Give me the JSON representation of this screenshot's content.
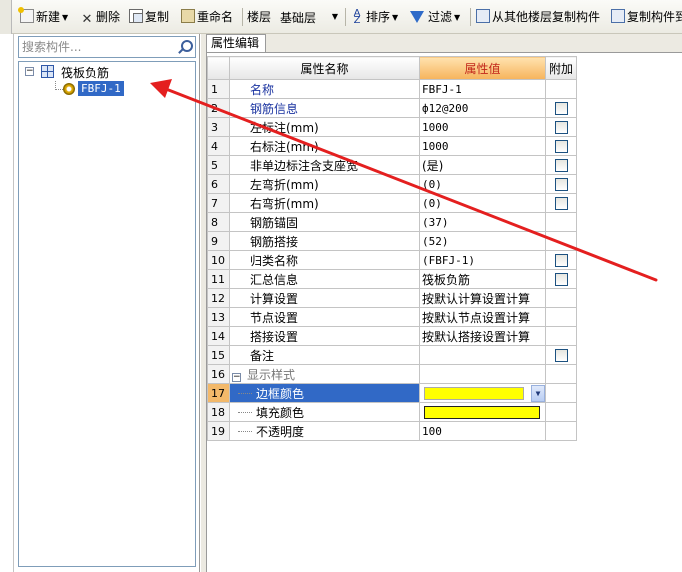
{
  "toolbar": {
    "new_label": "新建",
    "delete_label": "删除",
    "copy_label": "复制",
    "rename_label": "重命名",
    "floor_label": "楼层",
    "floor_value": "基础层",
    "sort_label": "排序",
    "filter_label": "过滤",
    "copy_from_floor_label": "从其他楼层复制构件",
    "copy_component_label": "复制构件到"
  },
  "left_panel": {
    "search_placeholder": "搜索构件...",
    "tree": {
      "root_label": "筏板负筋",
      "child_label": "FBFJ-1"
    }
  },
  "right_panel": {
    "tab_label": "属性编辑",
    "headers": {
      "name": "属性名称",
      "value": "属性值",
      "extra": "附加"
    },
    "rows": [
      {
        "num": "1",
        "name": "名称",
        "value": "FBFJ-1"
      },
      {
        "num": "2",
        "name": "钢筋信息",
        "value": "ф12@200"
      },
      {
        "num": "3",
        "name": "左标注(mm)",
        "value": "1000"
      },
      {
        "num": "4",
        "name": "右标注(mm)",
        "value": "1000"
      },
      {
        "num": "5",
        "name": "非单边标注含支座宽",
        "value": "(是)"
      },
      {
        "num": "6",
        "name": "左弯折(mm)",
        "value": "(0)"
      },
      {
        "num": "7",
        "name": "右弯折(mm)",
        "value": "(0)"
      },
      {
        "num": "8",
        "name": "钢筋锚固",
        "value": "(37)"
      },
      {
        "num": "9",
        "name": "钢筋搭接",
        "value": "(52)"
      },
      {
        "num": "10",
        "name": "归类名称",
        "value": "(FBFJ-1)"
      },
      {
        "num": "11",
        "name": "汇总信息",
        "value": "筏板负筋"
      },
      {
        "num": "12",
        "name": "计算设置",
        "value": "按默认计算设置计算"
      },
      {
        "num": "13",
        "name": "节点设置",
        "value": "按默认节点设置计算"
      },
      {
        "num": "14",
        "name": "搭接设置",
        "value": "按默认搭接设置计算"
      },
      {
        "num": "15",
        "name": "备注",
        "value": ""
      },
      {
        "num": "16",
        "name": "显示样式",
        "value": ""
      },
      {
        "num": "17",
        "name": "边框颜色",
        "value": ""
      },
      {
        "num": "18",
        "name": "填充颜色",
        "value": ""
      },
      {
        "num": "19",
        "name": "不透明度",
        "value": "100"
      }
    ]
  },
  "colors": {
    "highlight_yellow": "#ffff00",
    "selection_blue": "#3169c6",
    "arrow_red": "#e41f1f"
  }
}
